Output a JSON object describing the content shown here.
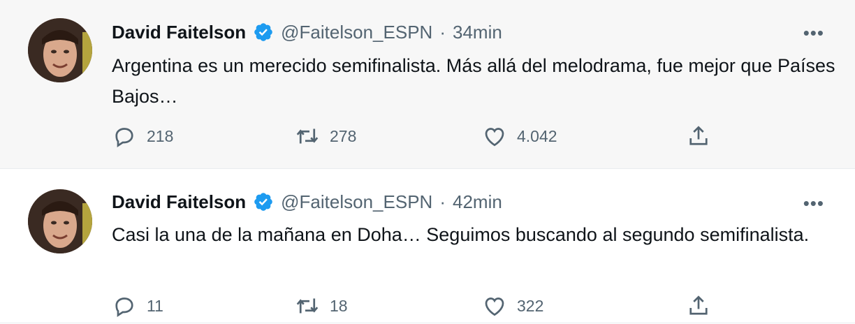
{
  "tweets": [
    {
      "name": "David Faitelson",
      "handle": "@Faitelson_ESPN",
      "separator": "·",
      "time": "34min",
      "text": "Argentina es un merecido semifinalista. Más allá del melodrama, fue mejor que Países Bajos…",
      "replies": "218",
      "retweets": "278",
      "likes": "4.042",
      "more": "•••"
    },
    {
      "name": "David Faitelson",
      "handle": "@Faitelson_ESPN",
      "separator": "·",
      "time": "42min",
      "text": "Casi la una de la mañana en Doha… Seguimos buscando al segundo semifinalista.",
      "replies": "11",
      "retweets": "18",
      "likes": "322",
      "more": "•••"
    }
  ],
  "colors": {
    "verified": "#1d9bf0",
    "secondary_text": "#536471",
    "primary_text": "#0f1419",
    "hover_background": "#f7f7f7"
  },
  "icons": [
    "verified-badge-icon",
    "more-icon",
    "reply-icon",
    "retweet-icon",
    "like-icon",
    "share-icon"
  ]
}
